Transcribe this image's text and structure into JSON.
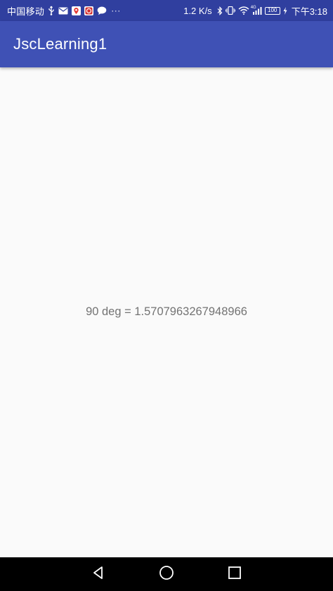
{
  "status_bar": {
    "carrier": "中国移动",
    "net_speed": "1.2 K/s",
    "network_type": "4G",
    "battery": "100",
    "time": "下午3:18",
    "overflow": "···",
    "icons": [
      "usb-icon",
      "mail-icon",
      "map-app-icon",
      "photo-app-icon",
      "chat-icon",
      "bluetooth-icon",
      "vibrate-icon",
      "wifi-icon",
      "signal-icon",
      "charging-icon"
    ]
  },
  "app_bar": {
    "title": "JscLearning1",
    "color": "#3f51b5",
    "status_color": "#303f9f"
  },
  "content": {
    "result_text": "90 deg = 1.5707963267948966"
  },
  "nav_bar": {
    "buttons": [
      "back-icon",
      "home-icon",
      "recents-icon"
    ]
  }
}
